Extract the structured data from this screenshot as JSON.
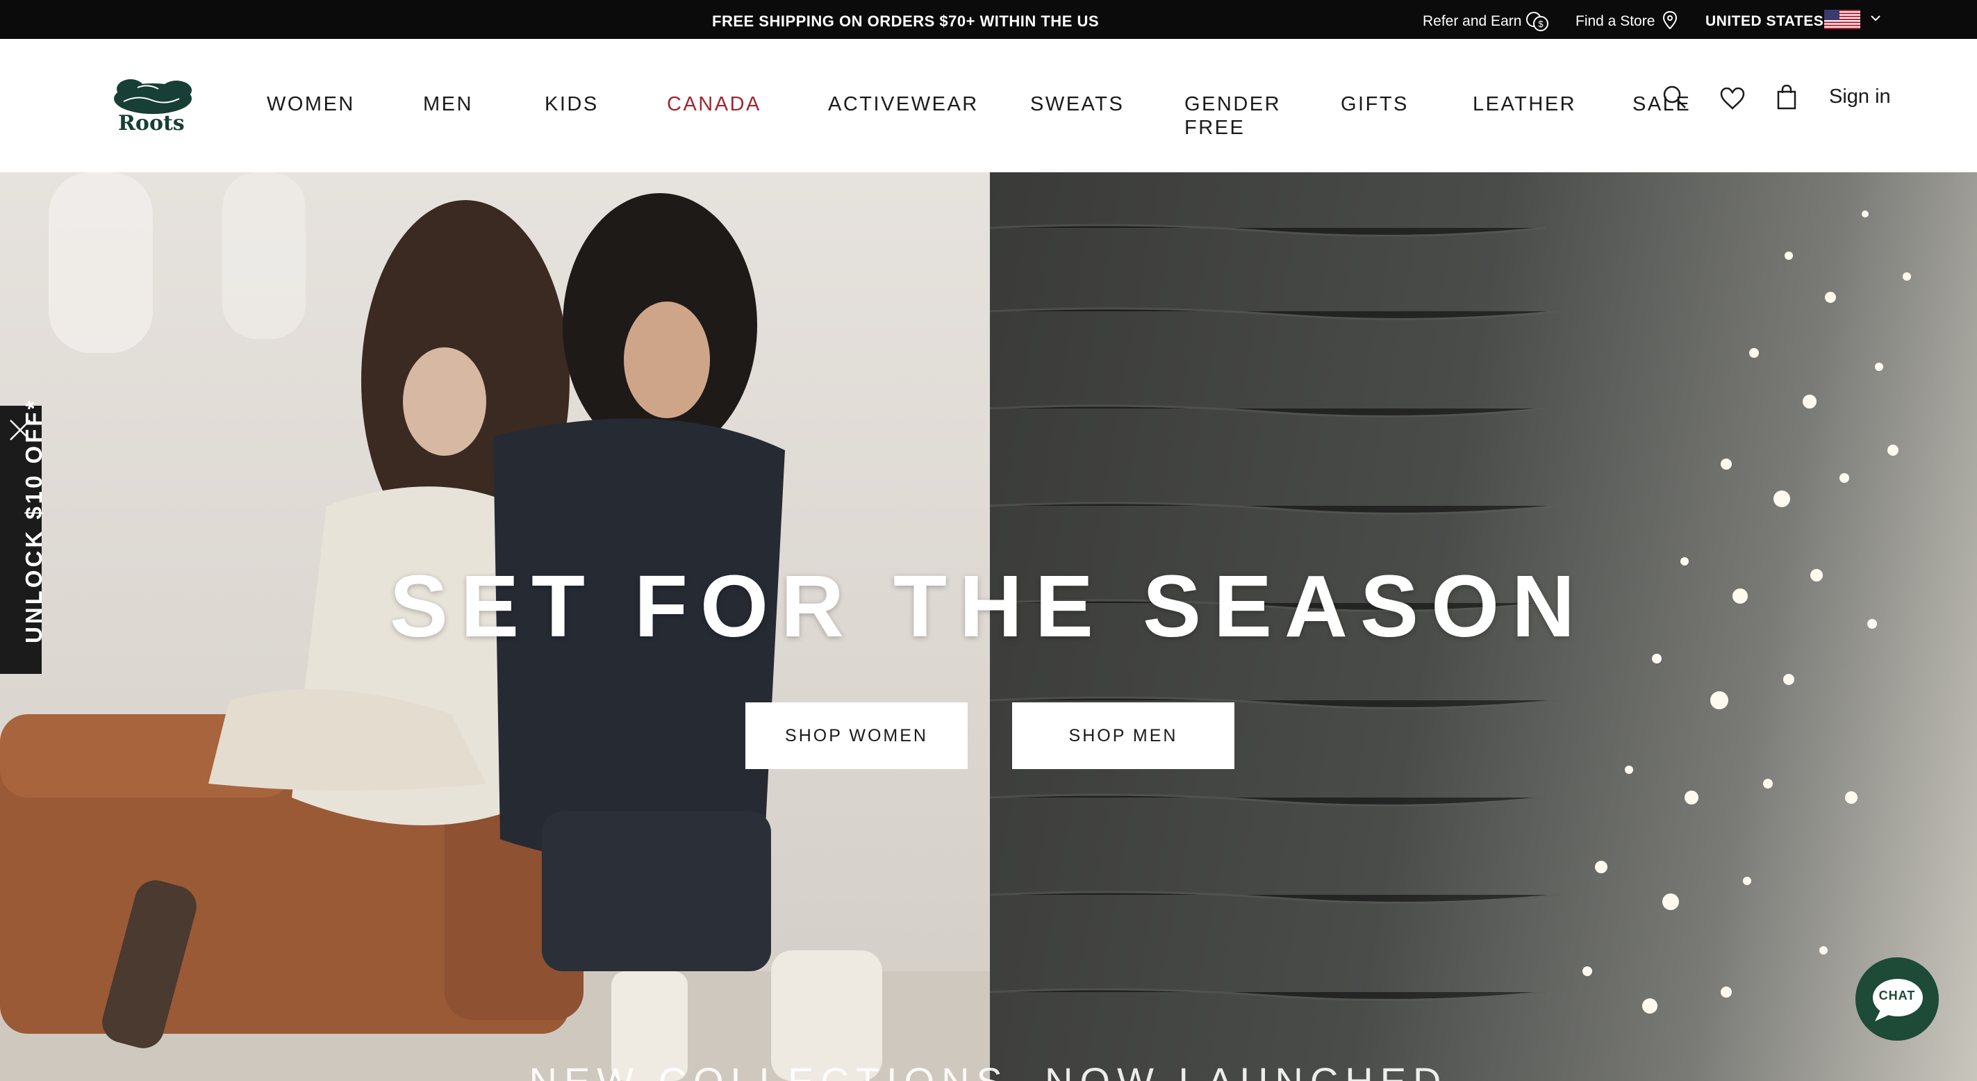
{
  "topbar": {
    "promo": "FREE SHIPPING ON ORDERS $70+ WITHIN THE US",
    "refer_label": "Refer and Earn",
    "store_label": "Find a Store",
    "country_label": "UNITED STATES",
    "icons": [
      "coins-icon",
      "location-pin-icon",
      "us-flag-icon",
      "chevron-down-icon"
    ]
  },
  "header": {
    "logo_text": "Roots",
    "nav": [
      "WOMEN",
      "MEN",
      "KIDS",
      "CANADA",
      "ACTIVEWEAR",
      "SWEATS",
      "GENDER",
      "FREE",
      "GIFTS",
      "LEATHER",
      "SALE"
    ],
    "signin_label": "Sign in",
    "icons": [
      "search-icon",
      "heart-icon",
      "shopping-bag-icon"
    ]
  },
  "hero": {
    "title": "SET FOR THE SEASON",
    "buttons": [
      "SHOP WOMEN",
      "SHOP MEN"
    ],
    "subtitle": "NEW COLLECTIONS. NOW LAUNCHED"
  },
  "promo_tab": {
    "label": "UNLOCK $10 OFF*"
  },
  "chat": {
    "label": "CHAT"
  },
  "colors": {
    "brand_green": "#1e4a38",
    "accent_red": "#a3262f",
    "topbar_bg": "#0b0b0b"
  }
}
